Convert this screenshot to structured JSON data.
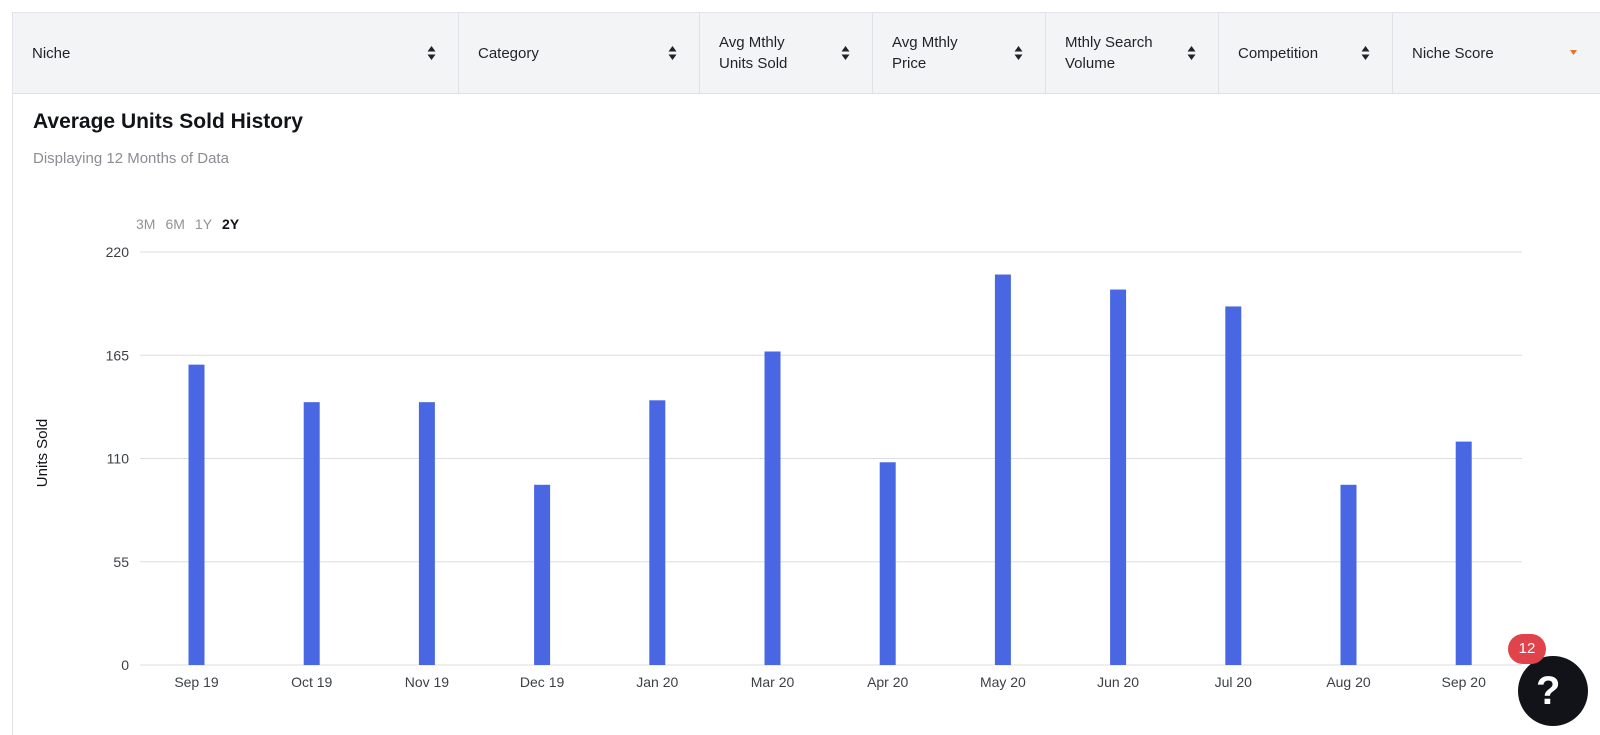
{
  "table": {
    "columns": [
      {
        "label": "Niche",
        "sort": "both"
      },
      {
        "label": "Category",
        "sort": "both"
      },
      {
        "label": "Avg Mthly\nUnits Sold",
        "sort": "both"
      },
      {
        "label": "Avg Mthly\nPrice",
        "sort": "both"
      },
      {
        "label": "Mthly Search\nVolume",
        "sort": "both"
      },
      {
        "label": "Competition",
        "sort": "both"
      },
      {
        "label": "Niche Score",
        "sort": "desc"
      }
    ]
  },
  "panel": {
    "title": "Average Units Sold History",
    "subtitle": "Displaying 12 Months of Data",
    "ranges": [
      "3M",
      "6M",
      "1Y",
      "2Y"
    ],
    "active_range": "2Y"
  },
  "notification": {
    "count": "12",
    "help_glyph": "?"
  },
  "colors": {
    "bar": "#4a67e3",
    "grid": "#dcdde0",
    "sort_active": "#e8722c"
  },
  "chart_data": {
    "type": "bar",
    "categories": [
      "Sep 19",
      "Oct 19",
      "Nov 19",
      "Dec 19",
      "Jan 20",
      "Mar 20",
      "Apr 20",
      "May 20",
      "Jun 20",
      "Jul 20",
      "Aug 20",
      "Sep 20"
    ],
    "values": [
      160,
      140,
      140,
      96,
      141,
      167,
      108,
      208,
      200,
      191,
      96,
      119
    ],
    "title": "",
    "xlabel": "",
    "ylabel": "Units Sold",
    "ylim": [
      0,
      220
    ],
    "yticks": [
      0,
      55,
      110,
      165,
      220
    ],
    "grid": true,
    "legend": "none"
  }
}
